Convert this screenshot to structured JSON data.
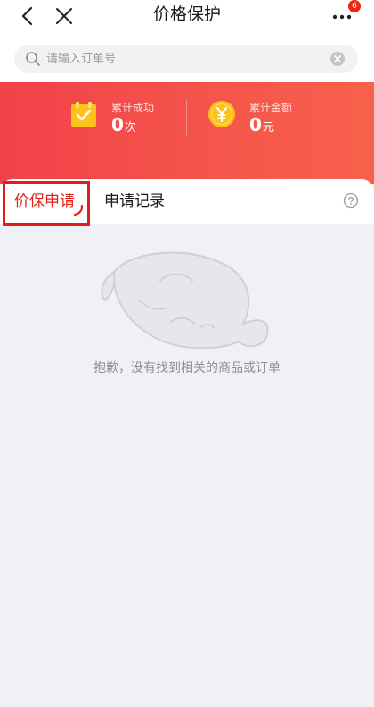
{
  "header": {
    "title": "价格保护",
    "badge_count": "6",
    "icons": {
      "back": "back-arrow-icon",
      "close": "close-icon",
      "more": "more-icon"
    }
  },
  "search": {
    "placeholder": "请输入订单号",
    "value": ""
  },
  "stats": [
    {
      "label": "累计成功",
      "value": "0",
      "unit": "次",
      "icon": "calendar-check-icon"
    },
    {
      "label": "累计金额",
      "value": "0",
      "unit": "元",
      "icon": "yen-coin-icon"
    }
  ],
  "tabs": [
    {
      "label": "价保申请",
      "active": true
    },
    {
      "label": "申请记录",
      "active": false
    }
  ],
  "empty_state": {
    "message": "抱歉，没有找到相关的商品或订单"
  },
  "colors": {
    "accent": "#e2231a",
    "banner_start": "#f24149",
    "banner_end": "#f7614b",
    "page_bg": "#f0f1f5",
    "icon_gold": "#ffc21a"
  }
}
